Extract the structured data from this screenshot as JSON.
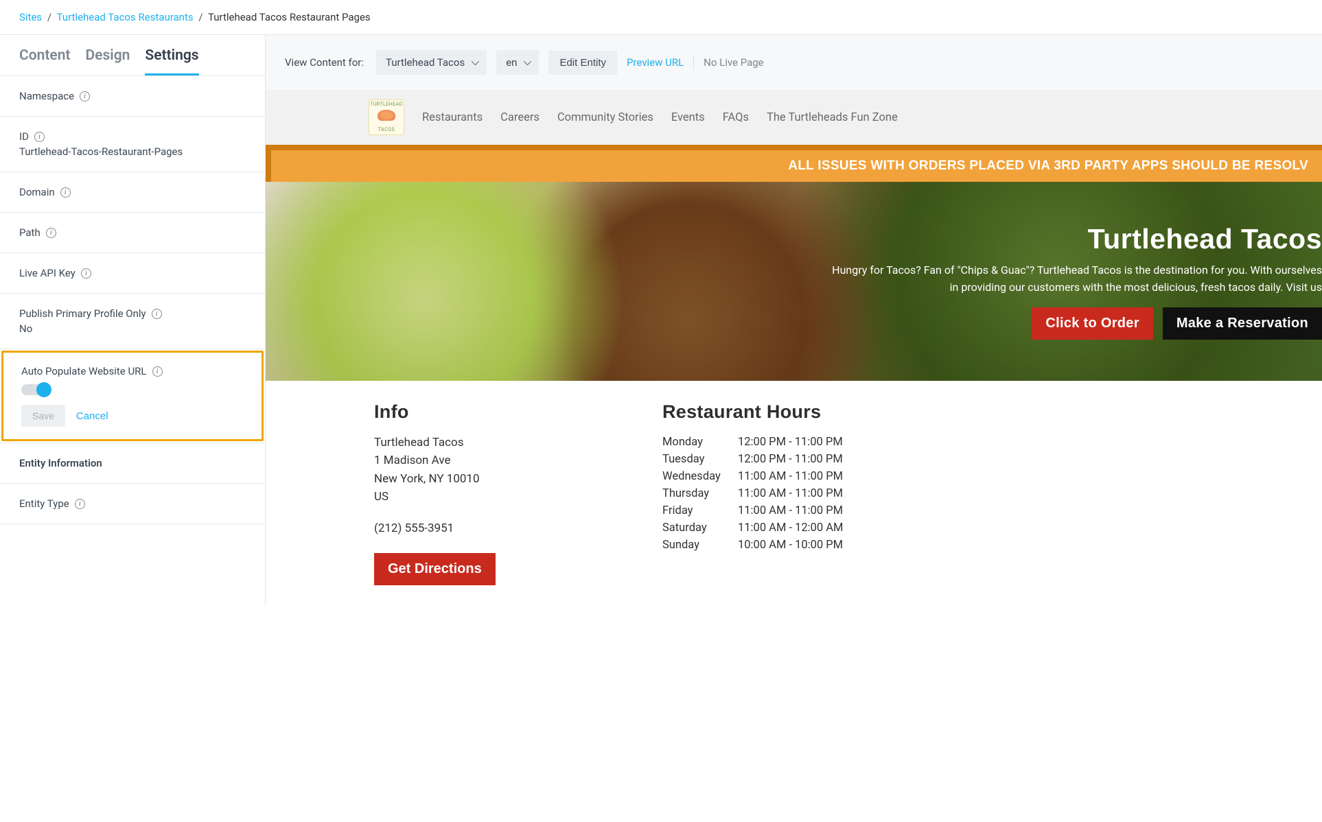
{
  "breadcrumb": {
    "sites": "Sites",
    "parent": "Turtlehead Tacos Restaurants",
    "current": "Turtlehead Tacos Restaurant Pages"
  },
  "tabs": {
    "content": "Content",
    "design": "Design",
    "settings": "Settings"
  },
  "settings": {
    "namespace_label": "Namespace",
    "id_label": "ID",
    "id_value": "Turtlehead-Tacos-Restaurant-Pages",
    "domain_label": "Domain",
    "path_label": "Path",
    "live_api_key_label": "Live API Key",
    "publish_primary_label": "Publish Primary Profile Only",
    "publish_primary_value": "No",
    "auto_populate_label": "Auto Populate Website URL",
    "save": "Save",
    "cancel": "Cancel",
    "entity_information_label": "Entity Information",
    "entity_type_label": "Entity Type"
  },
  "toolbar": {
    "view_label": "View Content for:",
    "entity": "Turtlehead Tacos",
    "locale": "en",
    "edit_entity": "Edit Entity",
    "preview_url": "Preview URL",
    "no_live_page": "No Live Page"
  },
  "site": {
    "nav": [
      "Restaurants",
      "Careers",
      "Community Stories",
      "Events",
      "FAQs",
      "The Turtleheads Fun Zone"
    ],
    "banner": "ALL ISSUES WITH ORDERS PLACED VIA 3RD PARTY APPS SHOULD BE RESOLV",
    "hero_title": "Turtlehead Tacos",
    "hero_sub": "Hungry for Tacos? Fan of \"Chips & Guac\"? Turtlehead Tacos is the destination for you. With ourselves in providing our customers with the most delicious, fresh tacos daily. Visit us",
    "order_btn": "Click to Order",
    "reserve_btn": "Make a Reservation",
    "info_heading": "Info",
    "info_name": "Turtlehead Tacos",
    "info_addr1": "1 Madison Ave",
    "info_addr2": "New York, NY 10010",
    "info_country": "US",
    "info_phone": "(212) 555-3951",
    "directions_btn": "Get Directions",
    "hours_heading": "Restaurant Hours",
    "hours": [
      {
        "day": "Monday",
        "time": "12:00 PM - 11:00 PM"
      },
      {
        "day": "Tuesday",
        "time": "12:00 PM - 11:00 PM"
      },
      {
        "day": "Wednesday",
        "time": "11:00 AM - 11:00 PM"
      },
      {
        "day": "Thursday",
        "time": "11:00 AM - 11:00 PM"
      },
      {
        "day": "Friday",
        "time": "11:00 AM - 11:00 PM"
      },
      {
        "day": "Saturday",
        "time": "11:00 AM - 12:00 AM"
      },
      {
        "day": "Sunday",
        "time": "10:00 AM - 10:00 PM"
      }
    ]
  }
}
